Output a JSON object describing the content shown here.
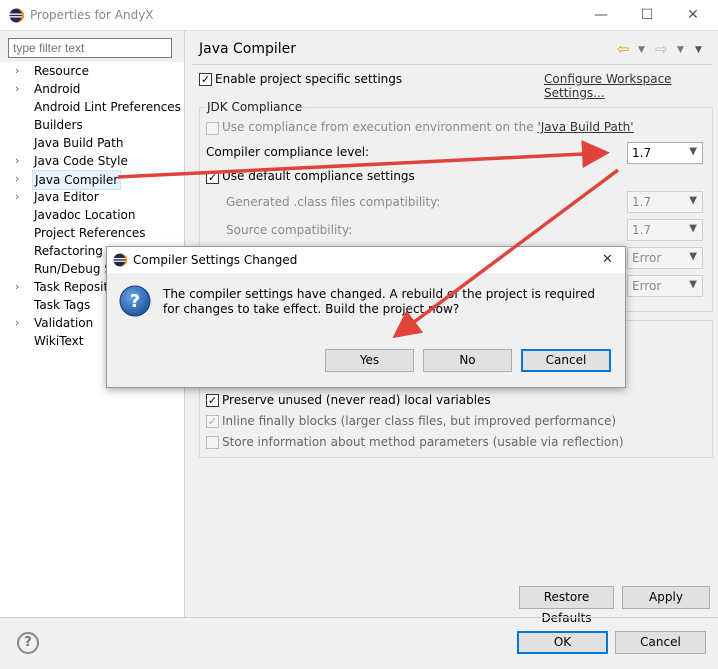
{
  "window": {
    "title": "Properties for AndyX",
    "minimize": "—",
    "maximize": "☐",
    "close": "✕"
  },
  "filter": {
    "placeholder": "type filter text"
  },
  "tree": [
    {
      "label": "Resource",
      "expandable": true
    },
    {
      "label": "Android",
      "expandable": true
    },
    {
      "label": "Android Lint Preferences",
      "expandable": false
    },
    {
      "label": "Builders",
      "expandable": false
    },
    {
      "label": "Java Build Path",
      "expandable": false
    },
    {
      "label": "Java Code Style",
      "expandable": true
    },
    {
      "label": "Java Compiler",
      "expandable": true,
      "selected": true
    },
    {
      "label": "Java Editor",
      "expandable": true
    },
    {
      "label": "Javadoc Location",
      "expandable": false
    },
    {
      "label": "Project References",
      "expandable": false
    },
    {
      "label": "Refactoring H",
      "expandable": false
    },
    {
      "label": "Run/Debug Se",
      "expandable": false
    },
    {
      "label": "Task Repositor",
      "expandable": true
    },
    {
      "label": "Task Tags",
      "expandable": false
    },
    {
      "label": "Validation",
      "expandable": true
    },
    {
      "label": "WikiText",
      "expandable": false
    }
  ],
  "page": {
    "title": "Java Compiler",
    "enable_specific": "Enable project specific settings",
    "configure_link": "Configure Workspace Settings...",
    "jdk_group": "JDK Compliance",
    "use_exec_env_prefix": "Use compliance from execution environment on the ",
    "use_exec_env_link": "'Java Build Path'",
    "compliance_label": "Compiler compliance level:",
    "compliance_value": "1.7",
    "use_default": "Use default compliance settings",
    "generated_label": "Generated .class files compatibility:",
    "generated_value": "1.7",
    "source_label": "Source compatibility:",
    "source_value": "1.7",
    "error1": "Error",
    "error2": "Error",
    "preserve_unused": "Preserve unused (never read) local variables",
    "inline_finally": "Inline finally blocks (larger class files, but improved performance)",
    "store_info": "Store information about method parameters (usable via reflection)",
    "restore_defaults": "Restore Defaults",
    "apply": "Apply"
  },
  "footer": {
    "ok": "OK",
    "cancel": "Cancel",
    "help": "?"
  },
  "dialog": {
    "title": "Compiler Settings Changed",
    "message": "The compiler settings have changed. A rebuild of the project is required for changes to take effect. Build the project now?",
    "yes": "Yes",
    "no": "No",
    "cancel": "Cancel",
    "close": "✕"
  },
  "colors": {
    "accent": "#0078d7",
    "arrow": "#e0433c",
    "selection": "#e5f3ff"
  }
}
